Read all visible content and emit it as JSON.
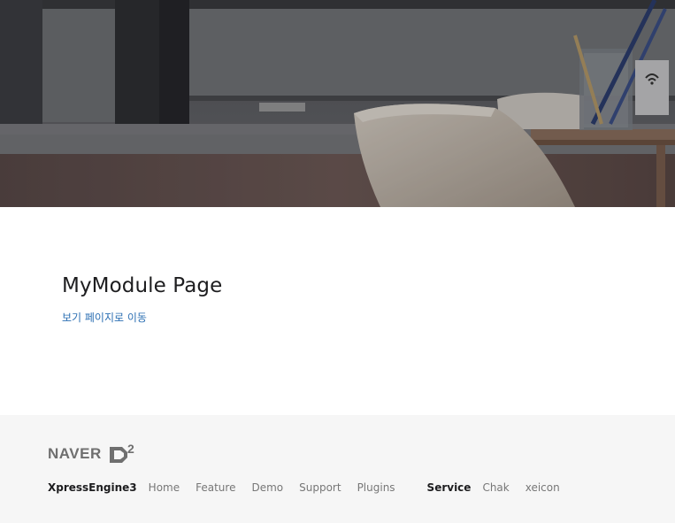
{
  "hero": {
    "image": "office-interior-photo"
  },
  "main": {
    "title": "MyModule Page",
    "view_link": "보기 페이지로 이동"
  },
  "footer": {
    "logo_text": "NAVER",
    "logo_mark": "D",
    "logo_superscript": "2",
    "brand": "XpressEngine3",
    "nav": [
      "Home",
      "Feature",
      "Demo",
      "Support",
      "Plugins"
    ],
    "service_label": "Service",
    "service_links": [
      "Chak",
      "xeicon"
    ]
  },
  "colors": {
    "link": "#2c6fb3",
    "footer_bg": "#f6f6f6",
    "title": "#1d1d1f",
    "nav_text": "#777777"
  }
}
